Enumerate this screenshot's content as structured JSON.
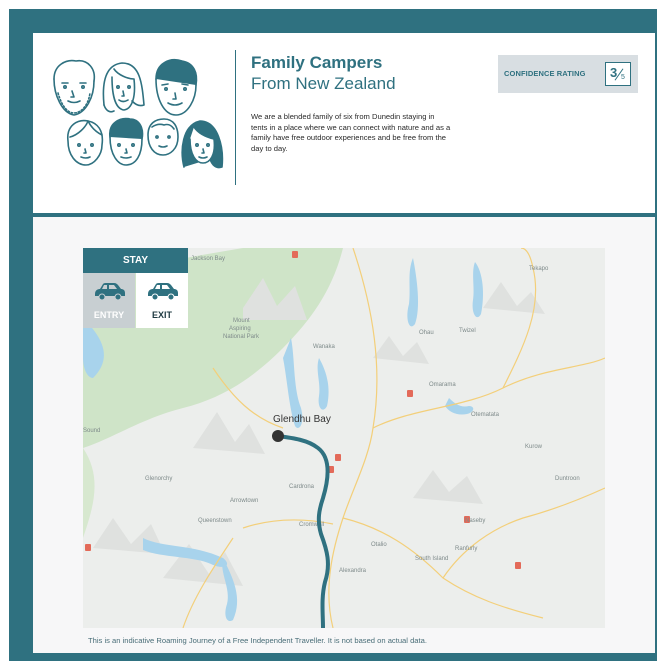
{
  "header": {
    "title": "Family Campers",
    "subtitle": "From New Zealand",
    "description": "We are a blended family of six from Dunedin staying in tents in a place where we can connect with nature and as a family have free outdoor experiences and be free from the day to day."
  },
  "confidence": {
    "label": "CONFIDENCE RATING",
    "value": "3",
    "out_of": "5"
  },
  "stay": {
    "header": "STAY",
    "entry_label": "ENTRY",
    "exit_label": "EXIT",
    "selected": "exit"
  },
  "map": {
    "highlight_place": "Glendhu Bay",
    "places": [
      {
        "id": "jackson-bay",
        "text": "Jackson Bay"
      },
      {
        "id": "mount-aspiring",
        "text": "Mount Aspiring National Park"
      },
      {
        "id": "wanaka",
        "text": "Wanaka"
      },
      {
        "id": "cardrona",
        "text": "Cardrona"
      },
      {
        "id": "arrowtown",
        "text": "Arrowtown"
      },
      {
        "id": "queenstown",
        "text": "Queenstown"
      },
      {
        "id": "cromwell",
        "text": "Cromwell"
      },
      {
        "id": "alexandra",
        "text": "Alexandra"
      },
      {
        "id": "tekapo",
        "text": "Tekapo"
      },
      {
        "id": "twizel",
        "text": "Twizel"
      },
      {
        "id": "ohau",
        "text": "Ohau"
      },
      {
        "id": "omarama",
        "text": "Omarama"
      },
      {
        "id": "otematata",
        "text": "Otematata"
      },
      {
        "id": "kurow",
        "text": "Kurow"
      },
      {
        "id": "duntroon",
        "text": "Duntroon"
      },
      {
        "id": "naseby",
        "text": "Naseby"
      },
      {
        "id": "ranfurly",
        "text": "Ranfurly"
      },
      {
        "id": "south-island",
        "text": "South Island"
      },
      {
        "id": "oturehua",
        "text": "Otalio"
      },
      {
        "id": "glenorchy",
        "text": "Glenorchy"
      },
      {
        "id": "haast-sound",
        "text": "Sound"
      }
    ],
    "colors": {
      "route": "#2f7180",
      "land": "#eef0ef",
      "forest": "#cfe4c8",
      "water": "#a8d3ec",
      "road": "#f7d583"
    }
  },
  "footnote": "This is an indicative Roaming Journey of a Free Independent Traveller. It is not based on actual data.",
  "colors": {
    "brand": "#2f7180",
    "panel": "#d8dee2"
  }
}
